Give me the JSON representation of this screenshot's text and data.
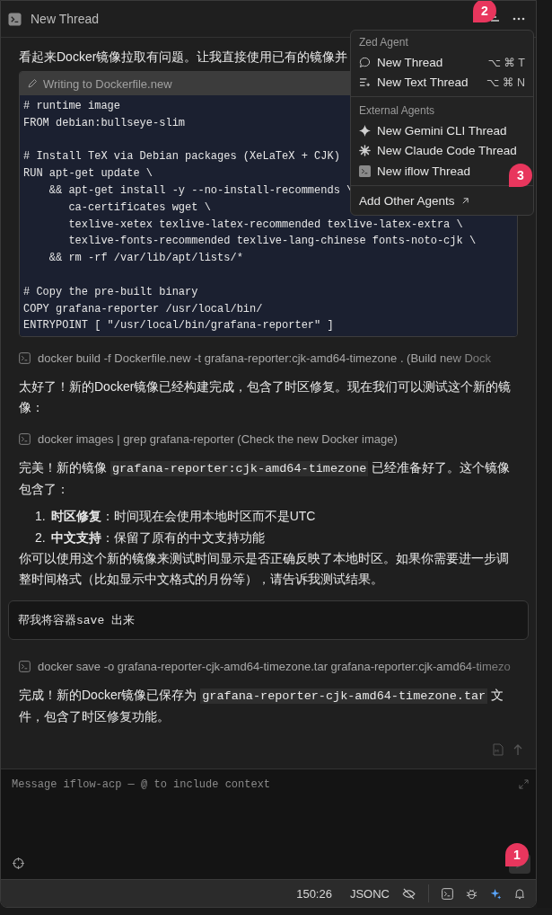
{
  "window": {
    "title": "New Thread",
    "callout": "2"
  },
  "thread": [
    {
      "kind": "text",
      "parts": [
        {
          "kind": "plain",
          "text": "看起来Docker镜像拉取有问题。让我直接使用已有的镜像并"
        }
      ],
      "clipped": true
    },
    {
      "kind": "file_write",
      "title": "Writing to Dockerfile.new",
      "blocks": [
        [
          "# runtime image",
          "FROM debian:bullseye-slim"
        ],
        [
          "# Install TeX via Debian packages (XeLaTeX + CJK)",
          "RUN apt-get update \\",
          "    && apt-get install -y --no-install-recommends \\",
          "       ca-certificates wget \\",
          "       texlive-xetex texlive-latex-recommended texlive-latex-extra \\",
          "       texlive-fonts-recommended texlive-lang-chinese fonts-noto-cjk \\",
          "    && rm -rf /var/lib/apt/lists/*"
        ],
        [
          "# Copy the pre-built binary",
          "COPY grafana-reporter /usr/local/bin/",
          "ENTRYPOINT [ \"/usr/local/bin/grafana-reporter\" ]"
        ]
      ]
    },
    {
      "kind": "command",
      "text": "docker build -f Dockerfile.new -t grafana-reporter:cjk-amd64-timezone . (Build new Dock",
      "faded": true
    },
    {
      "kind": "text",
      "parts": [
        {
          "kind": "plain",
          "text": "太好了！新的Docker镜像已经构建完成，包含了时区修复。现在我们可以测试这个新的镜像："
        }
      ],
      "clipped": false
    },
    {
      "kind": "command",
      "text": "docker images | grep grafana-reporter (Check the new Docker image)",
      "faded": false
    },
    {
      "kind": "text",
      "parts": [
        {
          "kind": "plain",
          "text": "完美！新的镜像 "
        },
        {
          "kind": "code",
          "text": "grafana-reporter:cjk-amd64-timezone"
        },
        {
          "kind": "plain",
          "text": " 已经准备好了。这个镜像包含了："
        }
      ],
      "clipped": false
    },
    {
      "kind": "list",
      "items": [
        {
          "number": "1.",
          "text": "**时区修复**：时间现在会使用本地时区而不是UTC"
        },
        {
          "number": "2.",
          "text": "**中文支持**：保留了原有的中文支持功能"
        }
      ]
    },
    {
      "kind": "text",
      "parts": [
        {
          "kind": "plain",
          "text": "你可以使用这个新的镜像来测试时间显示是否正确反映了本地时区。如果你需要进一步调整时间格式（比如显示中文格式的月份等），请告诉我测试结果。"
        }
      ],
      "clipped": false
    },
    {
      "kind": "user",
      "text": "帮我将容器save 出来"
    },
    {
      "kind": "command",
      "text": "docker save -o grafana-reporter-cjk-amd64-timezone.tar grafana-reporter:cjk-amd64-timezo",
      "faded": true
    },
    {
      "kind": "text",
      "parts": [
        {
          "kind": "plain",
          "text": "完成！新的Docker镜像已保存为 "
        },
        {
          "kind": "code",
          "text": "grafana-reporter-cjk-amd64-timezone.tar"
        },
        {
          "kind": "plain",
          "text": " 文件，包含了时区修复功能。"
        }
      ],
      "clipped": false
    }
  ],
  "menu": {
    "callout": "3",
    "sections": [
      {
        "heading": "Zed Agent",
        "items": [
          {
            "kind": "thread",
            "label": "New Thread",
            "shortcut": "⌥ ⌘ T"
          },
          {
            "kind": "text_thread",
            "label": "New Text Thread",
            "shortcut": "⌥ ⌘ N"
          }
        ]
      },
      {
        "heading": "External Agents",
        "items": [
          {
            "kind": "gemini",
            "label": "New Gemini CLI Thread"
          },
          {
            "kind": "claude",
            "label": "New Claude Code Thread"
          },
          {
            "kind": "terminal",
            "label": "New iflow Thread"
          }
        ]
      },
      {
        "items": [
          {
            "kind": "external",
            "label": "Add Other Agents"
          }
        ]
      }
    ]
  },
  "composer": {
    "placeholder": "Message iflow-acp — @ to include context",
    "callout": "1"
  },
  "status_bar": {
    "position": "150:26",
    "language": "JSONC"
  }
}
